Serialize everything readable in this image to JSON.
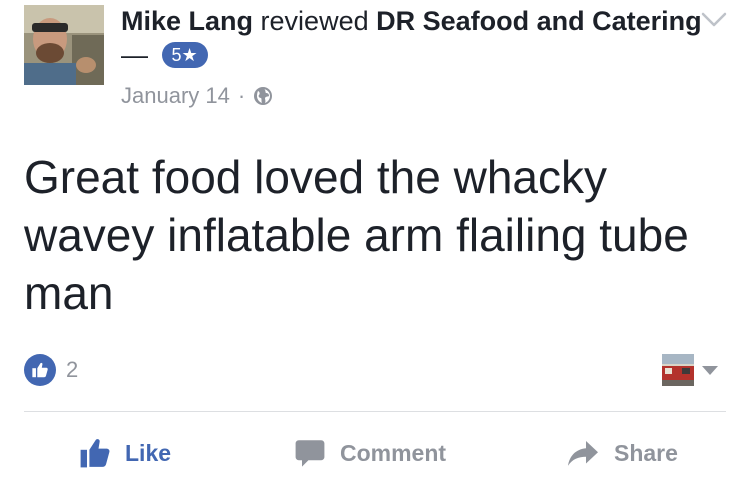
{
  "review": {
    "author": "Mike Lang",
    "verb": "reviewed",
    "page_name": "DR Seafood and Catering",
    "dash": "—",
    "rating_label": "5★",
    "date": "January 14",
    "separator": "·",
    "privacy_icon": "globe-icon",
    "text": "Great food loved the whacky wavey inflatable arm flailing tube man"
  },
  "reactions": {
    "icon": "like-icon",
    "count": "2"
  },
  "actions": {
    "like_label": "Like",
    "comment_label": "Comment",
    "share_label": "Share"
  },
  "colors": {
    "accent": "#4267b2",
    "text": "#1d2129",
    "muted": "#90949c",
    "divider": "#dddfe2"
  }
}
